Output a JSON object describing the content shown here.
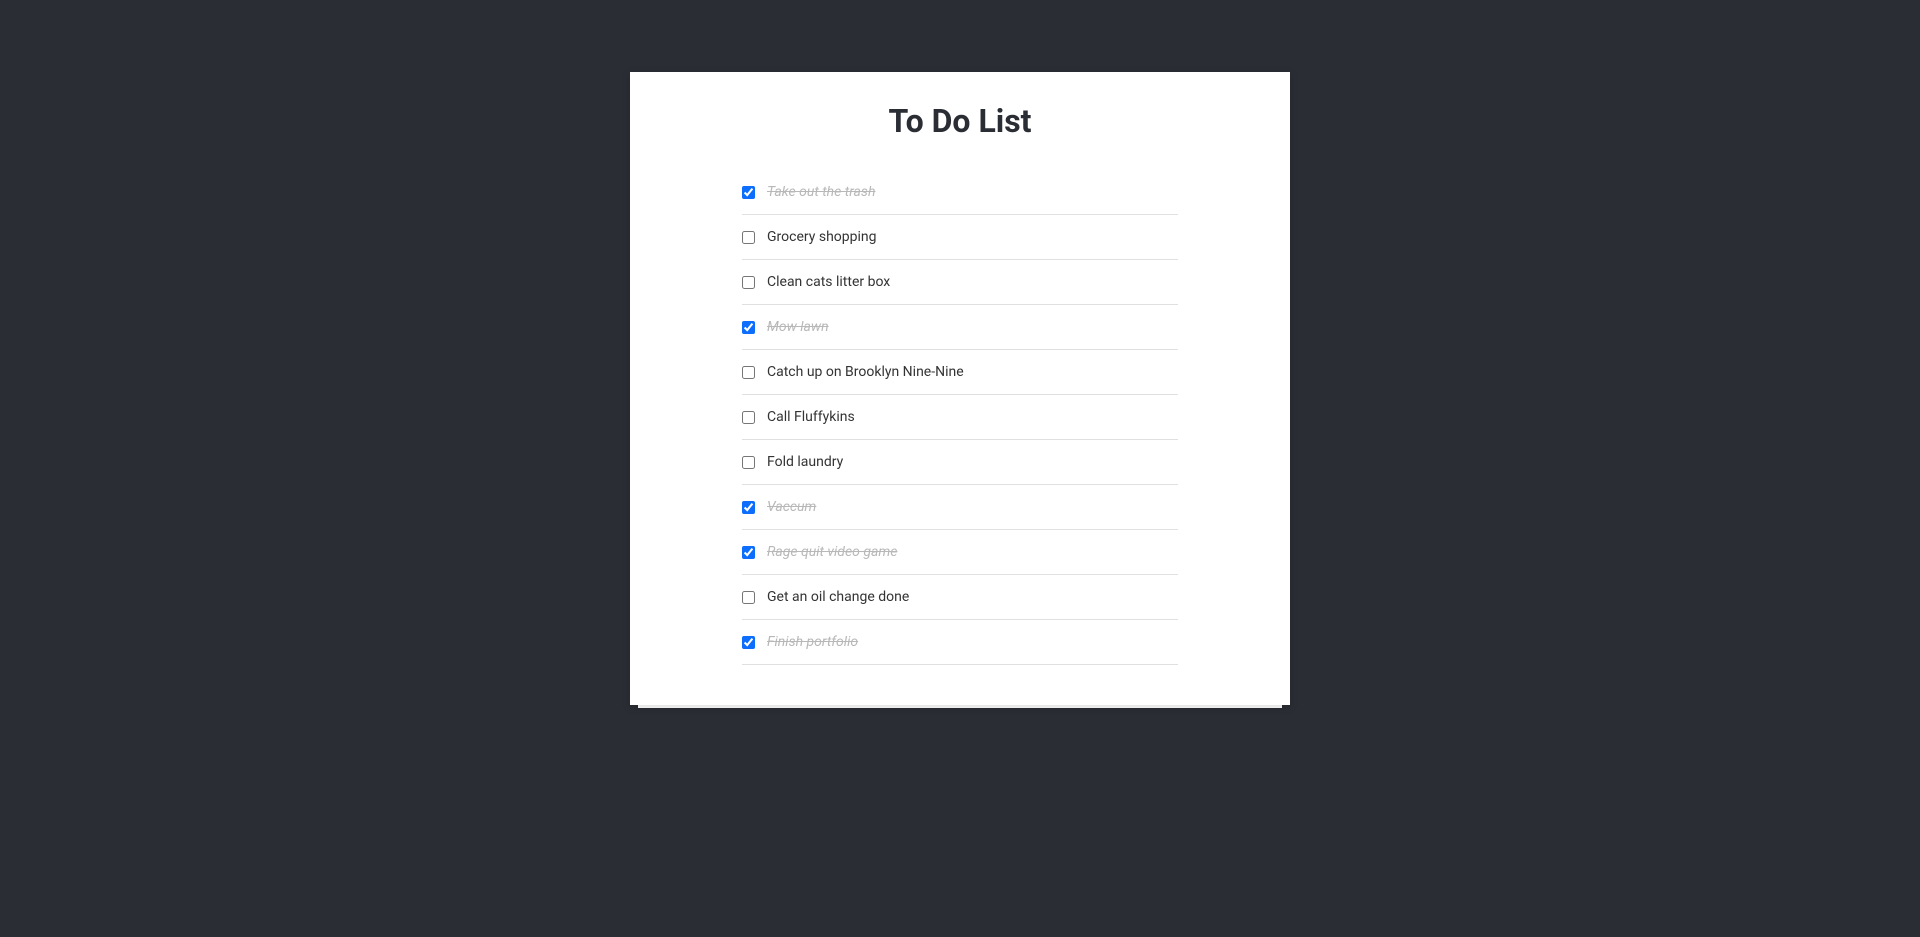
{
  "title": "To Do List",
  "items": [
    {
      "label": "Take out the trash",
      "completed": true
    },
    {
      "label": "Grocery shopping",
      "completed": false
    },
    {
      "label": "Clean cats litter box",
      "completed": false
    },
    {
      "label": "Mow lawn",
      "completed": true
    },
    {
      "label": "Catch up on Brooklyn Nine-Nine",
      "completed": false
    },
    {
      "label": "Call Fluffykins",
      "completed": false
    },
    {
      "label": "Fold laundry",
      "completed": false
    },
    {
      "label": "Vaccum",
      "completed": true
    },
    {
      "label": "Rage quit video game",
      "completed": true
    },
    {
      "label": "Get an oil change done",
      "completed": false
    },
    {
      "label": "Finish portfolio",
      "completed": true
    }
  ]
}
